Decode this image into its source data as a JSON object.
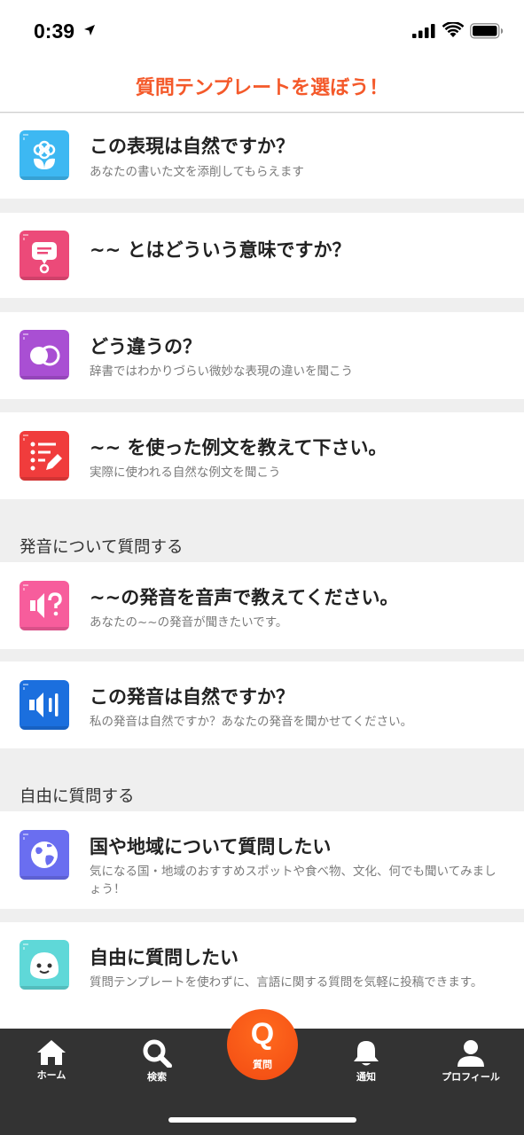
{
  "status_bar": {
    "time": "0:39"
  },
  "header": {
    "title": "質問テンプレートを選ぼう！"
  },
  "templates": [
    {
      "title": "この表現は自然ですか？",
      "subtitle": "あなたの書いた文を添削してもらえます",
      "icon": "flower-icon",
      "color": "#3db8f2"
    },
    {
      "title": "~~ とはどういう意味ですか？",
      "subtitle": "",
      "icon": "speech-bubble-icon",
      "color": "#ec4a79"
    },
    {
      "title": "どう違うの？",
      "subtitle": "辞書ではわかりづらい微妙な表現の違いを聞こう",
      "icon": "overlap-circles-icon",
      "color": "#a94fd3"
    },
    {
      "title": "~~ を使った例文を教えて下さい。",
      "subtitle": "実際に使われる自然な例文を聞こう",
      "icon": "list-pencil-icon",
      "color": "#f03c3c"
    }
  ],
  "pronunciation": {
    "heading": "発音について質問する",
    "items": [
      {
        "title": "~~の発音を音声で教えてください。",
        "subtitle": "あなたの~~の発音が聞きたいです。",
        "icon": "speaker-question-icon",
        "color": "#f75d9c"
      },
      {
        "title": "この発音は自然ですか？",
        "subtitle": "私の発音は自然ですか？あなたの発音を聞かせてください。",
        "icon": "speaker-sound-icon",
        "color": "#1b6fde"
      }
    ]
  },
  "free": {
    "heading": "自由に質問する",
    "items": [
      {
        "title": "国や地域について質問したい",
        "subtitle": "気になる国・地域のおすすめスポットや食べ物、文化、何でも聞いてみましょう！",
        "icon": "globe-icon",
        "color": "#6a6ef0"
      },
      {
        "title": "自由に質問したい",
        "subtitle": "質問テンプレートを使わずに、言語に関する質問を気軽に投稿できます。",
        "icon": "smiley-face-icon",
        "color": "#5fd8d8"
      }
    ]
  },
  "tab_bar": {
    "home": "ホーム",
    "search": "検索",
    "question": "質問",
    "question_glyph": "Q",
    "notifications": "通知",
    "profile": "プロフィール"
  }
}
